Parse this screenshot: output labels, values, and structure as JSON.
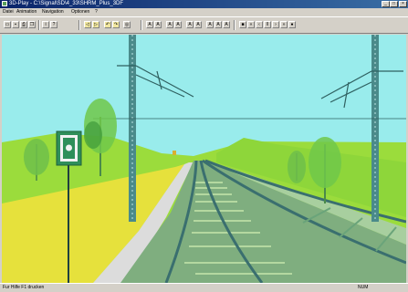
{
  "window": {
    "title": "3D-Play - C:\\Signal\\SD\\4_33\\SHRM_Plus_3DF",
    "minimize_glyph": "_",
    "maximize_glyph": "□",
    "close_glyph": "×"
  },
  "menu": {
    "items": [
      "Datei",
      "Animation",
      "Navigation",
      "Optionen",
      "?"
    ]
  },
  "toolbar": {
    "file_buttons": [
      "open-icon",
      "save-icon",
      "print-icon",
      "copy-icon",
      "info-icon",
      "help-icon"
    ],
    "nav_buttons": [
      "walk-back-icon",
      "walk-forward-icon",
      "turn-left-icon",
      "turn-right-icon",
      "view-icon"
    ],
    "text_buttons": [
      "A",
      "A",
      "A",
      "A",
      "A",
      "A",
      "A",
      "A",
      "A"
    ],
    "playback_buttons": [
      "stop-icon",
      "rewind-icon",
      "back-icon",
      "pause-icon",
      "forward-icon",
      "fast-forward-icon",
      "record-icon"
    ]
  },
  "scene": {
    "sky_color": "#99ecec",
    "grass_color": "#9bdc3c",
    "field_color": "#e6e13c",
    "ballast_color": "#7fae7f",
    "path_color": "#dcdcdc",
    "rail_color": "#3a6f6f",
    "signal_color": "#2f8f5a"
  },
  "status": {
    "left_text": "Fur Hilfe F1 drucken",
    "right_text": "NUM"
  }
}
